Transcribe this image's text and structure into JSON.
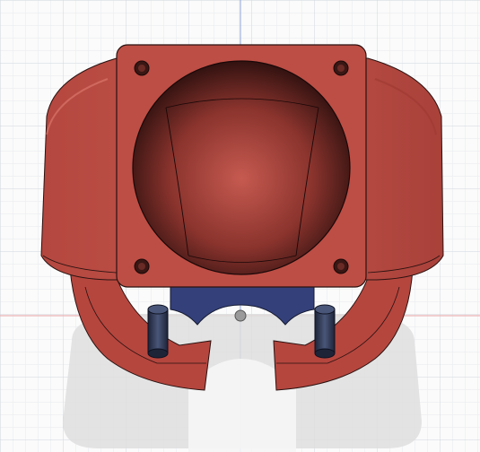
{
  "viewport": {
    "colors": {
      "background": "#fbfbfb",
      "grid_minor": "#e7eaee",
      "grid_major": "#cfd6de",
      "axis_vertical": "#8fa2d8",
      "axis_horizontal": "#e7a3a3",
      "body": "#b84a42",
      "body_light": "#c95a50",
      "body_dark": "#6a2a25",
      "edge": "#2a1210",
      "rod": "#303a58",
      "bracket": "#34407a",
      "shadow": "#d9d9d9"
    }
  },
  "model": {
    "parts": [
      "fan-mount-plate",
      "fan-duct-opening",
      "duct-shroud",
      "mounting-holes",
      "standoff-rods",
      "mount-bracket",
      "origin-point"
    ]
  }
}
